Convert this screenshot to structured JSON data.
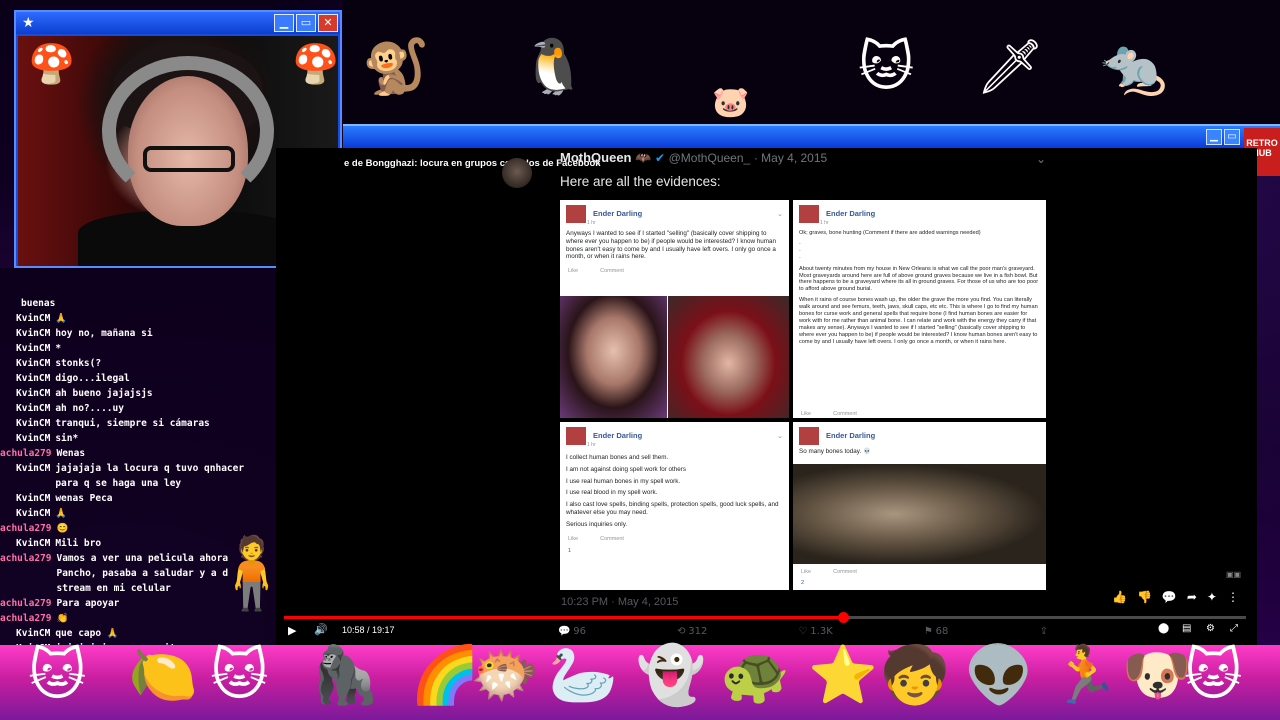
{
  "webcam": {
    "star_icon": "★",
    "buttons": [
      "▁",
      "▭",
      "✕"
    ]
  },
  "chat": [
    {
      "user": "",
      "msg": "buenas",
      "alt": false
    },
    {
      "user": "KvinCM",
      "msg": "🙏",
      "alt": false
    },
    {
      "user": "KvinCM",
      "msg": "hoy no, mañana si",
      "alt": false
    },
    {
      "user": "KvinCM",
      "msg": "*",
      "alt": false
    },
    {
      "user": "KvinCM",
      "msg": "stonks(?",
      "alt": false
    },
    {
      "user": "KvinCM",
      "msg": "digo...ilegal",
      "alt": false
    },
    {
      "user": "KvinCM",
      "msg": "ah bueno jajajsjs",
      "alt": false
    },
    {
      "user": "KvinCM",
      "msg": "ah no?....uy",
      "alt": false
    },
    {
      "user": "KvinCM",
      "msg": "tranqui, siempre si cámaras",
      "alt": false
    },
    {
      "user": "KvinCM",
      "msg": "sin*",
      "alt": false
    },
    {
      "user": "achula279",
      "msg": "Wenas",
      "alt": true
    },
    {
      "user": "KvinCM",
      "msg": "jajajaja la locura q tuvo qnhacer para q se haga una ley",
      "alt": false
    },
    {
      "user": "KvinCM",
      "msg": "wenas Peca",
      "alt": false
    },
    {
      "user": "KvinCM",
      "msg": "🙏",
      "alt": false
    },
    {
      "user": "achula279",
      "msg": "😊",
      "alt": true
    },
    {
      "user": "KvinCM",
      "msg": "Mili bro",
      "alt": false
    },
    {
      "user": "achula279",
      "msg": "Vamos a ver una pelicula ahora Pancho, pasaba a saludar y a d stream en mi celular",
      "alt": true
    },
    {
      "user": "achula279",
      "msg": "Para apoyar",
      "alt": true
    },
    {
      "user": "achula279",
      "msg": "👏",
      "alt": true
    },
    {
      "user": "KvinCM",
      "msg": "que capo 🙏",
      "alt": false
    },
    {
      "user": "KvinCM",
      "msg": "jajajajaja yo necesito una nueva",
      "alt": false
    }
  ],
  "video": {
    "title": "e de Bongghazi: locura en grupos cerrados de Facebook",
    "tweet": {
      "name": "MothQueen",
      "badges": "🦇",
      "verified": "✔",
      "handle": "@MothQueen_",
      "date": "· May 4, 2015",
      "text": "Here are all the evidences:",
      "timestamp": "10:23 PM · May 4, 2015",
      "replies": "96",
      "retweets": "312",
      "likes": "1.3K",
      "bookmarks": "68"
    },
    "posts": [
      {
        "author": "Ender Darling",
        "time": "1 hr",
        "body": [
          "Anyways I wanted to see if I started \"selling\" (basically cover shipping to where ever you happen to be) if people would be interested? I know human bones aren't easy to come by and I usually have left overs. I only go once a month, or when it rains here."
        ],
        "like": "Like",
        "comment": "Comment"
      },
      {
        "author": "Ender Darling",
        "time": "1 hr",
        "body": [
          "Ok; graves, bone hunting (Comment if there are added warnings needed)",
          "·",
          "·",
          "·",
          "About twenty minutes from my house in New Orleans is what we call the poor man's graveyard. Most graveyards around here are full of above ground graves because we live in a fish bowl. But there happens to be a graveyard where its all in ground graves. For those of us who are too poor to afford above ground burial.",
          "When it rains of course bones wash up, the older the grave the more you find. You can literally walk around and see femurs, teeth, jaws, skull caps, etc etc. This is where I go to find my human bones for curse work and general spells that require bone (I find human bones are easier for work with for me rather than animal bone. I can relate and work with the energy they carry if that makes any sense). Anyways I wanted to see if I started \"selling\" (basically cover shipping to where ever you happen to be) if people would be interested? I know human bones aren't easy to come by and I usually have left overs. I only go once a month, or when it rains here."
        ],
        "like": "Like",
        "comment": "Comment"
      },
      {
        "author": "Ender Darling",
        "time": "1 hr",
        "body": [
          "I collect human bones and sell them.",
          "I am not against doing spell work for others",
          "I use real human bones in my spell work.",
          "I use real blood in my spell work.",
          "I also cast love spells, binding spells, protection spells, good luck spells, and whatever else you may need.",
          "Serious inquiries only."
        ],
        "like": "Like",
        "comment": "Comment",
        "reactions": "1"
      },
      {
        "author": "Ender Darling",
        "time": "1 hr",
        "body": [
          "So many bones today. 💀"
        ],
        "like": "Like",
        "comment": "Comment",
        "reactions": "2"
      }
    ]
  },
  "player": {
    "timecode": "10:58 / 19:17",
    "progress_fraction": 0.579,
    "play_icon": "▶",
    "volume_icon": "🔊"
  },
  "overlay": {
    "badge_text": "RETRO\nHUB"
  },
  "colors": {
    "accent_blue": "#2b7bff",
    "bottom_bar": "#ff3cc8",
    "progress_red": "#ff0000",
    "fb_link": "#385898"
  }
}
